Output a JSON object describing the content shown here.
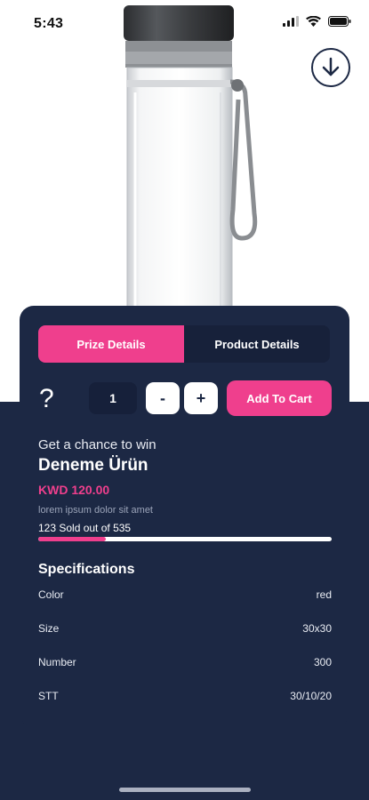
{
  "status": {
    "time": "5:43"
  },
  "tabs": [
    {
      "label": "Prize Details",
      "active": true
    },
    {
      "label": "Product Details",
      "active": false
    }
  ],
  "actions": {
    "help_glyph": "?",
    "quantity": "1",
    "minus": "-",
    "plus": "+",
    "add_to_cart": "Add To Cart"
  },
  "product": {
    "tagline": "Get a chance to win",
    "title": "Deneme Ürün",
    "price": "KWD 120.00",
    "description": "lorem ipsum dolor sit amet",
    "sold_text": "123 Sold out of 535",
    "sold": 123,
    "total": 535
  },
  "specifications": {
    "title": "Specifications",
    "rows": [
      {
        "key": "Color",
        "value": "red"
      },
      {
        "key": "Size",
        "value": "30x30"
      },
      {
        "key": "Number",
        "value": "300"
      },
      {
        "key": "STT",
        "value": "30/10/20"
      }
    ]
  },
  "colors": {
    "accent": "#ef3f8d",
    "navy": "#1c2844",
    "navy_dark": "#16203a"
  },
  "icons": {
    "download": "download-circle-icon",
    "wifi": "wifi-icon",
    "battery": "battery-icon",
    "signal": "signal-icon"
  }
}
